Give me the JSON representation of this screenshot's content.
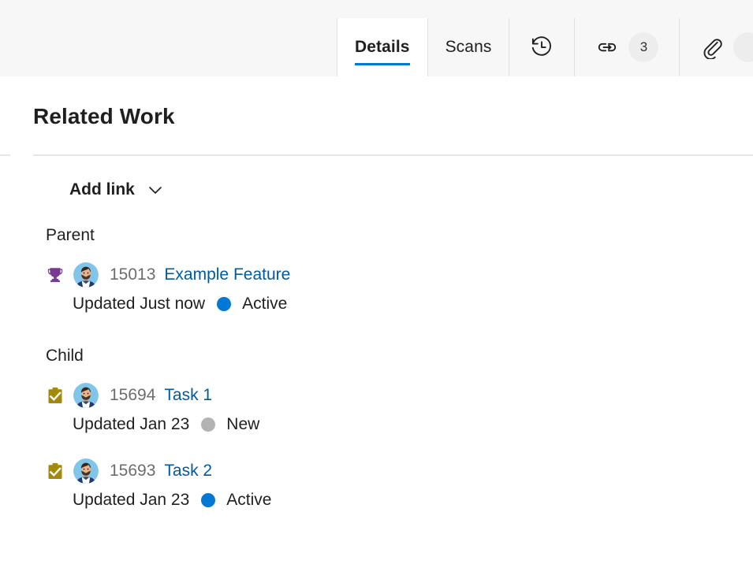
{
  "header": {
    "tabs": [
      {
        "id": "details",
        "label": "Details",
        "type": "text",
        "selected": true
      },
      {
        "id": "scans",
        "label": "Scans",
        "type": "text",
        "selected": false
      },
      {
        "id": "history",
        "label": "",
        "type": "icon",
        "icon": "history-icon",
        "selected": false
      },
      {
        "id": "links",
        "label": "",
        "type": "icon",
        "icon": "link-icon",
        "badge": "3",
        "selected": false
      },
      {
        "id": "attachments",
        "label": "",
        "type": "icon",
        "icon": "attachment-icon",
        "badge": "",
        "selected": false
      }
    ]
  },
  "main": {
    "page_title": "Related Work",
    "add_link": {
      "label": "Add link",
      "chevron_icon": "chevron-down-icon"
    },
    "groups": [
      {
        "name": "Parent",
        "items": [
          {
            "type_icon": "feature-trophy-icon",
            "type_color": "#773b93",
            "avatar_icon": "user-avatar",
            "id": "15013",
            "title": "Example Feature",
            "updated": "Updated Just now",
            "state": "Active",
            "state_color": "#0078d4"
          }
        ]
      },
      {
        "name": "Child",
        "items": [
          {
            "type_icon": "task-clipboard-icon",
            "type_color": "#a4880a",
            "avatar_icon": "user-avatar",
            "id": "15694",
            "title": "Task 1",
            "updated": "Updated Jan 23",
            "state": "New",
            "state_color": "#b3b3b3"
          },
          {
            "type_icon": "task-clipboard-icon",
            "type_color": "#a4880a",
            "avatar_icon": "user-avatar",
            "id": "15693",
            "title": "Task 2",
            "updated": "Updated Jan 23",
            "state": "Active",
            "state_color": "#0078d4"
          }
        ]
      }
    ]
  },
  "colors": {
    "accent": "#0078d4",
    "link": "#005a9e",
    "header_bg": "#f7f7f7",
    "divider": "#e6e6e6",
    "feature_purple": "#773b93",
    "task_yellow": "#a4880a",
    "state_new_gray": "#b3b3b3"
  }
}
